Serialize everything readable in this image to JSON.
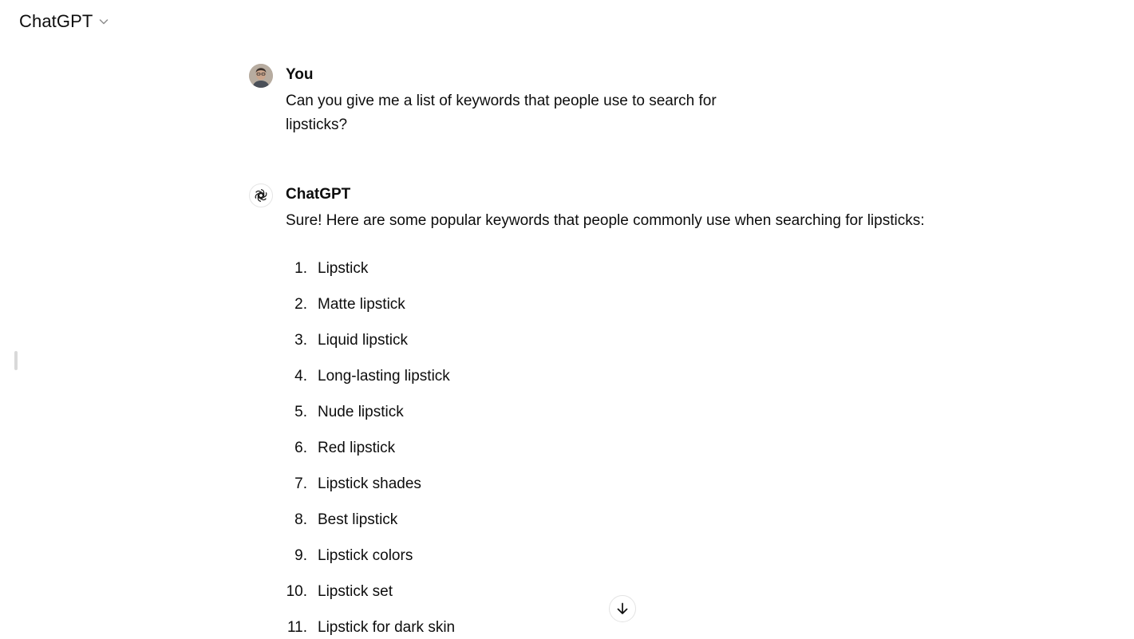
{
  "header": {
    "model_name": "ChatGPT",
    "dropdown_icon": "chevron-down-icon"
  },
  "conversation": {
    "user_message": {
      "author": "You",
      "text": "Can you give me a list of keywords that people use to search for lipsticks?",
      "avatar_icon": "user-avatar"
    },
    "assistant_message": {
      "author": "ChatGPT",
      "avatar_icon": "openai-logo-icon",
      "intro": "Sure! Here are some popular keywords that people commonly use when searching for lipsticks:",
      "items": [
        {
          "num": "1.",
          "label": "Lipstick"
        },
        {
          "num": "2.",
          "label": "Matte lipstick"
        },
        {
          "num": "3.",
          "label": "Liquid lipstick"
        },
        {
          "num": "4.",
          "label": "Long-lasting lipstick"
        },
        {
          "num": "5.",
          "label": "Nude lipstick"
        },
        {
          "num": "6.",
          "label": "Red lipstick"
        },
        {
          "num": "7.",
          "label": "Lipstick shades"
        },
        {
          "num": "8.",
          "label": "Best lipstick"
        },
        {
          "num": "9.",
          "label": "Lipstick colors"
        },
        {
          "num": "10.",
          "label": "Lipstick set"
        },
        {
          "num": "11.",
          "label": "Lipstick for dark skin"
        }
      ]
    }
  },
  "controls": {
    "scroll_down_icon": "arrow-down-icon"
  }
}
